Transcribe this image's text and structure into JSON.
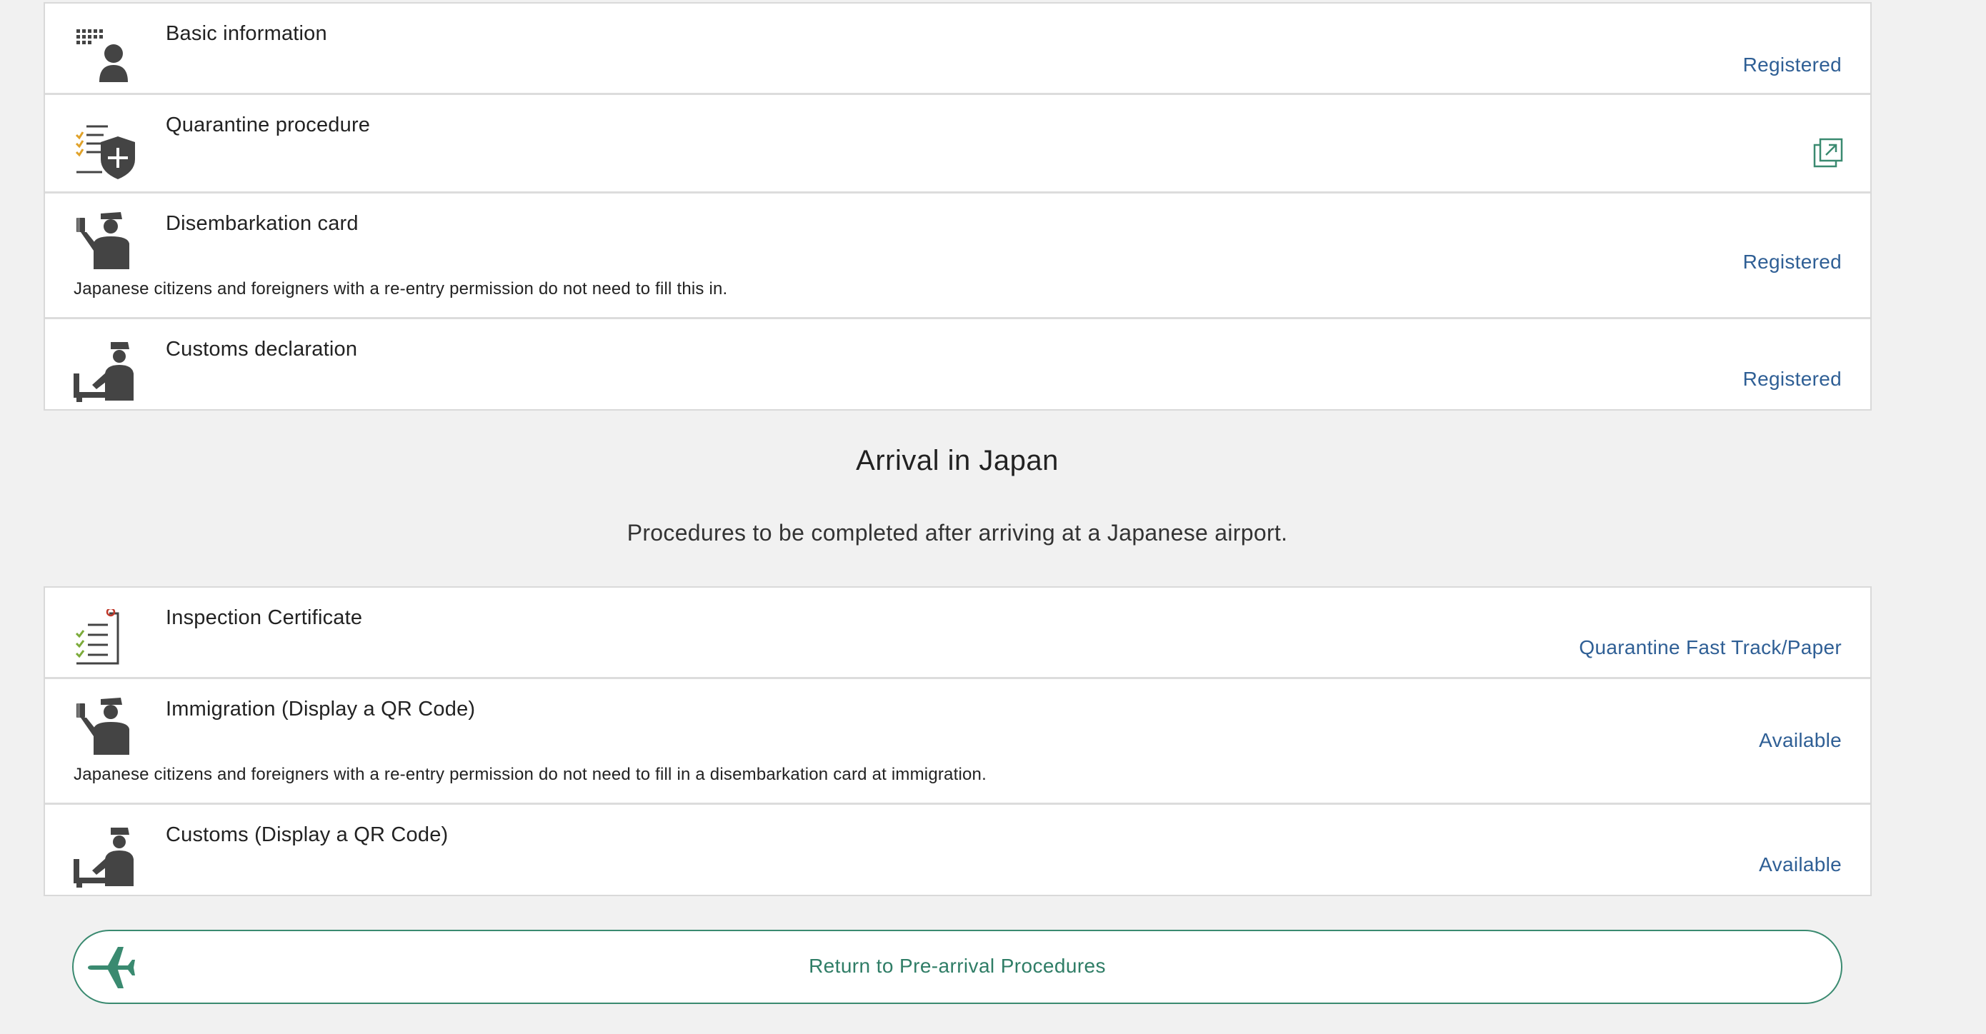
{
  "pre_arrival": {
    "items": [
      {
        "title": "Basic information",
        "status": "Registered",
        "icon": "person-keypad-icon"
      },
      {
        "title": "Quarantine procedure",
        "status": "",
        "icon": "quarantine-shield-icon",
        "action_icon": "external-link-icon"
      },
      {
        "title": "Disembarkation card",
        "status": "Registered",
        "note": "Japanese citizens and foreigners with a re-entry permission do not need to fill this in.",
        "icon": "immigration-officer-icon"
      },
      {
        "title": "Customs declaration",
        "status": "Registered",
        "icon": "customs-officer-icon"
      }
    ]
  },
  "arrival": {
    "heading": "Arrival in Japan",
    "subheading": "Procedures to be completed after arriving at a Japanese airport.",
    "items": [
      {
        "title": "Inspection Certificate",
        "status": "Quarantine Fast Track/Paper",
        "icon": "checklist-icon"
      },
      {
        "title": "Immigration (Display a QR Code)",
        "status": "Available",
        "note": "Japanese citizens and foreigners with a re-entry permission do not need to fill in a disembarkation card at immigration.",
        "icon": "immigration-officer-icon"
      },
      {
        "title": "Customs (Display a QR Code)",
        "status": "Available",
        "icon": "customs-officer-icon"
      }
    ]
  },
  "return_button": {
    "label": "Return to Pre-arrival Procedures",
    "icon": "airplane-icon"
  },
  "colors": {
    "status_link": "#2f5f95",
    "accent_green": "#3a8a70",
    "icon_gray": "#444444",
    "background": "#f1f1f1"
  }
}
